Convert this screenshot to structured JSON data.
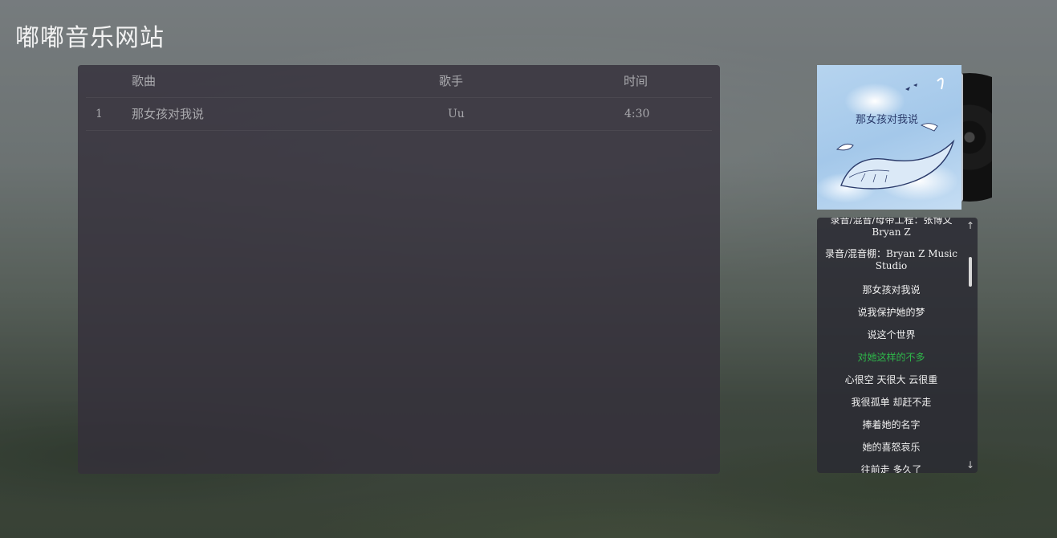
{
  "site": {
    "title": "嘟嘟音乐网站"
  },
  "song_list": {
    "headers": {
      "index": "",
      "song": "歌曲",
      "singer": "歌手",
      "duration": "时间"
    },
    "rows": [
      {
        "index": "1",
        "song": "那女孩对我说",
        "singer": "Uu",
        "duration": "4:30"
      }
    ]
  },
  "lyrics": {
    "lines": [
      {
        "text": "录音/混音/母带工程：张博文 Bryan Z",
        "active": false
      },
      {
        "text": "录音/混音棚：Bryan Z Music Studio",
        "active": false
      },
      {
        "text": "那女孩对我说",
        "active": false
      },
      {
        "text": "说我保护她的梦",
        "active": false
      },
      {
        "text": "说这个世界",
        "active": false
      },
      {
        "text": "对她这样的不多",
        "active": true
      },
      {
        "text": "心很空 天很大 云很重",
        "active": false
      },
      {
        "text": "我很孤单 却赶不走",
        "active": false
      },
      {
        "text": "捧着她的名字",
        "active": false
      },
      {
        "text": "她的喜怒哀乐",
        "active": false
      },
      {
        "text": "往前走 多久了",
        "active": false
      }
    ],
    "active_color": "#2fb84a",
    "scroll_up_icon": "arrow-up-icon",
    "scroll_down_icon": "arrow-down-icon"
  },
  "album": {
    "cover_text": "那女孩对我说"
  }
}
